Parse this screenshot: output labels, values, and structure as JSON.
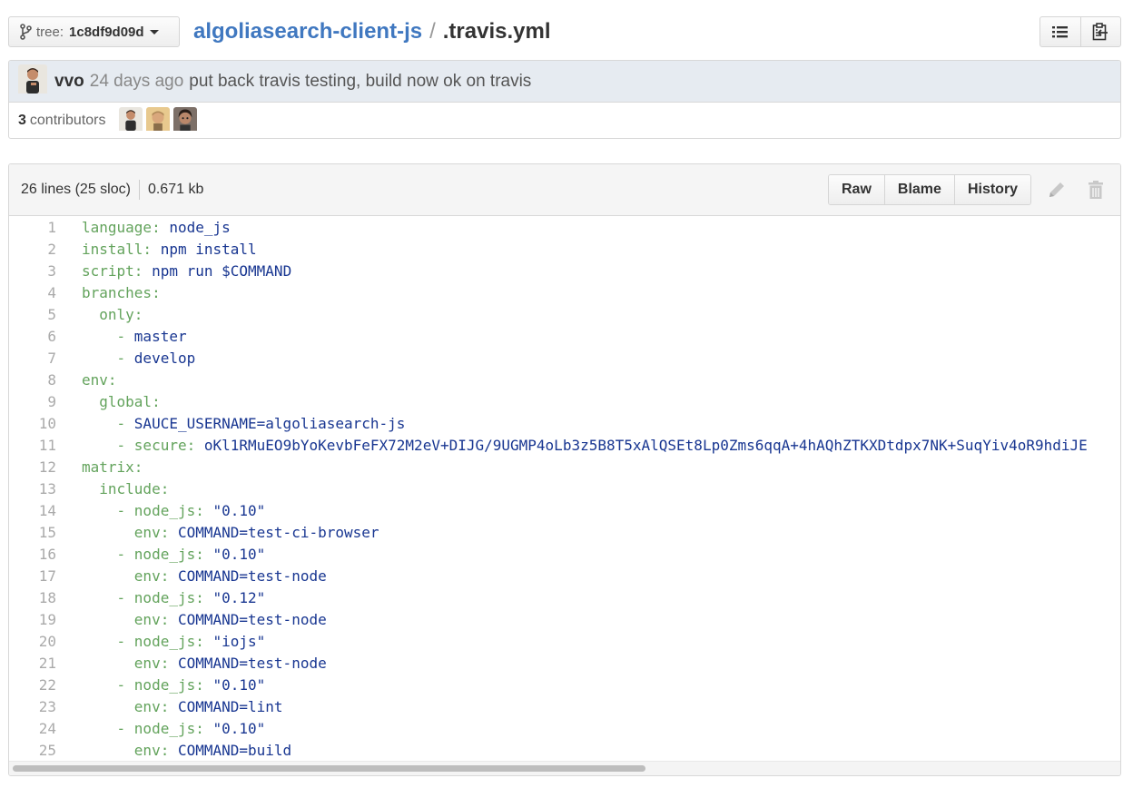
{
  "header": {
    "tree_label": "tree:",
    "tree_sha": "1c8df9d09d",
    "repo": "algoliasearch-client-js",
    "separator": "/",
    "file": ".travis.yml",
    "icons": [
      "list-icon",
      "clipboard-icon"
    ]
  },
  "commit": {
    "author": "vvo",
    "time_ago": "24 days ago",
    "message": "put back travis testing, build now ok on travis",
    "contributors_count": "3",
    "contributors_label": "contributors"
  },
  "file": {
    "lines_info": "26 lines (25 sloc)",
    "size": "0.671 kb",
    "buttons": {
      "raw": "Raw",
      "blame": "Blame",
      "history": "History"
    }
  },
  "code_lines": [
    {
      "n": "1",
      "indent": "",
      "dash": "",
      "key": "language:",
      "val": " node_js"
    },
    {
      "n": "2",
      "indent": "",
      "dash": "",
      "key": "install:",
      "val": " npm install"
    },
    {
      "n": "3",
      "indent": "",
      "dash": "",
      "key": "script:",
      "val": " npm run $COMMAND"
    },
    {
      "n": "4",
      "indent": "",
      "dash": "",
      "key": "branches:",
      "val": ""
    },
    {
      "n": "5",
      "indent": "  ",
      "dash": "",
      "key": "only:",
      "val": ""
    },
    {
      "n": "6",
      "indent": "    ",
      "dash": "- ",
      "key": "",
      "val": "master"
    },
    {
      "n": "7",
      "indent": "    ",
      "dash": "- ",
      "key": "",
      "val": "develop"
    },
    {
      "n": "8",
      "indent": "",
      "dash": "",
      "key": "env:",
      "val": ""
    },
    {
      "n": "9",
      "indent": "  ",
      "dash": "",
      "key": "global:",
      "val": ""
    },
    {
      "n": "10",
      "indent": "    ",
      "dash": "- ",
      "key": "",
      "val": "SAUCE_USERNAME=algoliasearch-js"
    },
    {
      "n": "11",
      "indent": "    ",
      "dash": "- ",
      "key": "secure:",
      "val": " oKl1RMuEO9bYoKevbFeFX72M2eV+DIJG/9UGMP4oLb3z5B8T5xAlQSEt8Lp0Zms6qqA+4hAQhZTKXDtdpx7NK+SuqYiv4oR9hdiJE"
    },
    {
      "n": "12",
      "indent": "",
      "dash": "",
      "key": "matrix:",
      "val": ""
    },
    {
      "n": "13",
      "indent": "  ",
      "dash": "",
      "key": "include:",
      "val": ""
    },
    {
      "n": "14",
      "indent": "    ",
      "dash": "- ",
      "key": "node_js:",
      "val": " \"0.10\""
    },
    {
      "n": "15",
      "indent": "      ",
      "dash": "",
      "key": "env:",
      "val": " COMMAND=test-ci-browser"
    },
    {
      "n": "16",
      "indent": "    ",
      "dash": "- ",
      "key": "node_js:",
      "val": " \"0.10\""
    },
    {
      "n": "17",
      "indent": "      ",
      "dash": "",
      "key": "env:",
      "val": " COMMAND=test-node"
    },
    {
      "n": "18",
      "indent": "    ",
      "dash": "- ",
      "key": "node_js:",
      "val": " \"0.12\""
    },
    {
      "n": "19",
      "indent": "      ",
      "dash": "",
      "key": "env:",
      "val": " COMMAND=test-node"
    },
    {
      "n": "20",
      "indent": "    ",
      "dash": "- ",
      "key": "node_js:",
      "val": " \"iojs\""
    },
    {
      "n": "21",
      "indent": "      ",
      "dash": "",
      "key": "env:",
      "val": " COMMAND=test-node"
    },
    {
      "n": "22",
      "indent": "    ",
      "dash": "- ",
      "key": "node_js:",
      "val": " \"0.10\""
    },
    {
      "n": "23",
      "indent": "      ",
      "dash": "",
      "key": "env:",
      "val": " COMMAND=lint"
    },
    {
      "n": "24",
      "indent": "    ",
      "dash": "- ",
      "key": "node_js:",
      "val": " \"0.10\""
    },
    {
      "n": "25",
      "indent": "      ",
      "dash": "",
      "key": "env:",
      "val": " COMMAND=build"
    }
  ],
  "colors": {
    "link": "#4078c0",
    "yaml_key": "#63a35c",
    "yaml_value": "#183691",
    "commit_bg": "#e6ebf1"
  }
}
